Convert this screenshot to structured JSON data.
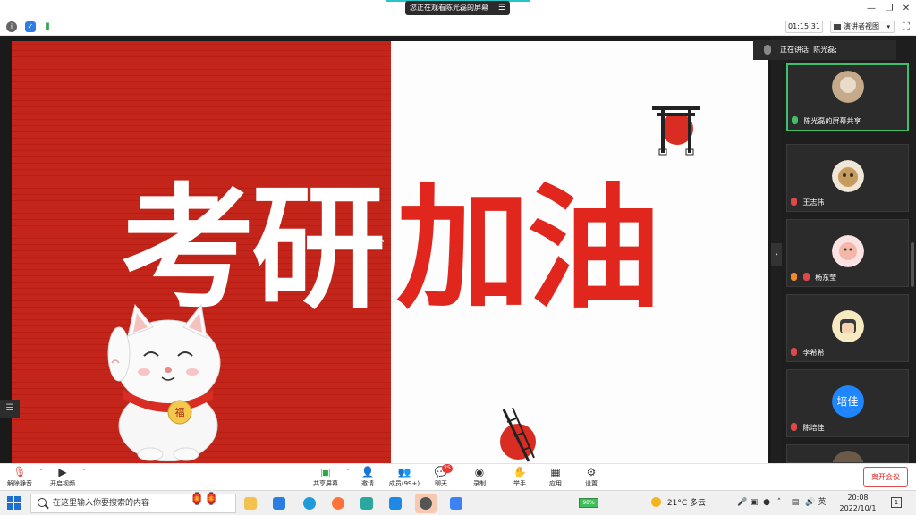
{
  "window": {
    "title": "您正在观看陈光磊的屏幕",
    "minimize_glyph": "—",
    "restore_glyph": "❐",
    "close_glyph": "✕"
  },
  "topbar": {
    "timer": "01:15:31",
    "view_button": "演讲者视图"
  },
  "slide": {
    "text_left": "考研",
    "text_right": "加油",
    "cat_badge": "福"
  },
  "panel": {
    "speaking": "正在讲话: 陈光磊;",
    "participants": [
      {
        "name": "陈光磊的屏幕共享",
        "active": true
      },
      {
        "name": "王志伟"
      },
      {
        "name": "杨东莹"
      },
      {
        "name": "李希希"
      },
      {
        "name": "陈培佳",
        "avatar_text": "培佳"
      },
      {
        "name": ""
      }
    ]
  },
  "toolbar": {
    "unmute": "解除静音",
    "start_video": "开启视频",
    "share": "共享屏幕",
    "invite": "邀请",
    "members": "成员(99+)",
    "chat": "聊天",
    "chat_badge": "25",
    "record": "录制",
    "raise_hand": "举手",
    "apps": "应用",
    "settings": "设置",
    "leave": "离开会议"
  },
  "taskbar": {
    "search_placeholder": "在这里输入你要搜索的内容",
    "battery": "98%",
    "weather": "21°C 多云",
    "time": "20:08",
    "date": "2022/10/1",
    "notification_count": "1",
    "ime": "英"
  },
  "colors": {
    "slide_red": "#c4251b",
    "slide_red_text": "#e0261d",
    "active_tile": "#3fbf6a",
    "leave_red": "#e34a4a",
    "badge_red": "#e53b3b",
    "avatar_blue": "#1f86ff"
  }
}
